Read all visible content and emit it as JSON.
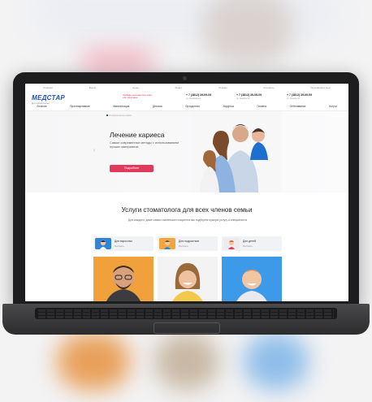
{
  "site": {
    "topnav": [
      "Клиники",
      "Врачи",
      "Цены",
      "Акции",
      "Отзывы",
      "Контакты",
      "Перезвоните мне"
    ],
    "logo": "МЕДСТАР",
    "logo_sub": "Для всей семьи",
    "slogan": "Любовь начинается там, где здоровье",
    "phones": [
      {
        "number": "+ 7 (3812) 39-09-09",
        "sub": "ул. Гагарина 14"
      },
      {
        "number": "+ 7 (3812) 39-09-09",
        "sub": "пр. Маркса 31"
      },
      {
        "number": "+ 7 (3812) 39-09-09",
        "sub": "ул. Ленина 47"
      }
    ],
    "menu": [
      "Лечение",
      "Протезирование",
      "Имплантация",
      "Детская",
      "Ортодонтия",
      "Хирургия",
      "Гигиена",
      "Отбеливание",
      "Услуги"
    ],
    "breadcrumb": "Стоматология Омск",
    "hero": {
      "title": "Лечение кариеса",
      "subtitle": "Самые современные методы с использованием лучших материалов",
      "button": "Подробнее",
      "prev": "‹",
      "next": "›"
    },
    "services": {
      "title": "Услуги стоматолога для всех членов семьи",
      "text": "Для каждого, даже самого маленького пациента мы подберём нужную услугу и специалиста",
      "cards": [
        {
          "label": "Для взрослых",
          "select": "Выбрать"
        },
        {
          "label": "Для подростков",
          "select": "Выбрать"
        },
        {
          "label": "Для детей",
          "select": "Выбрать"
        }
      ]
    }
  },
  "colors": {
    "brand": "#1e4fbf",
    "accent": "#e23a5c"
  }
}
